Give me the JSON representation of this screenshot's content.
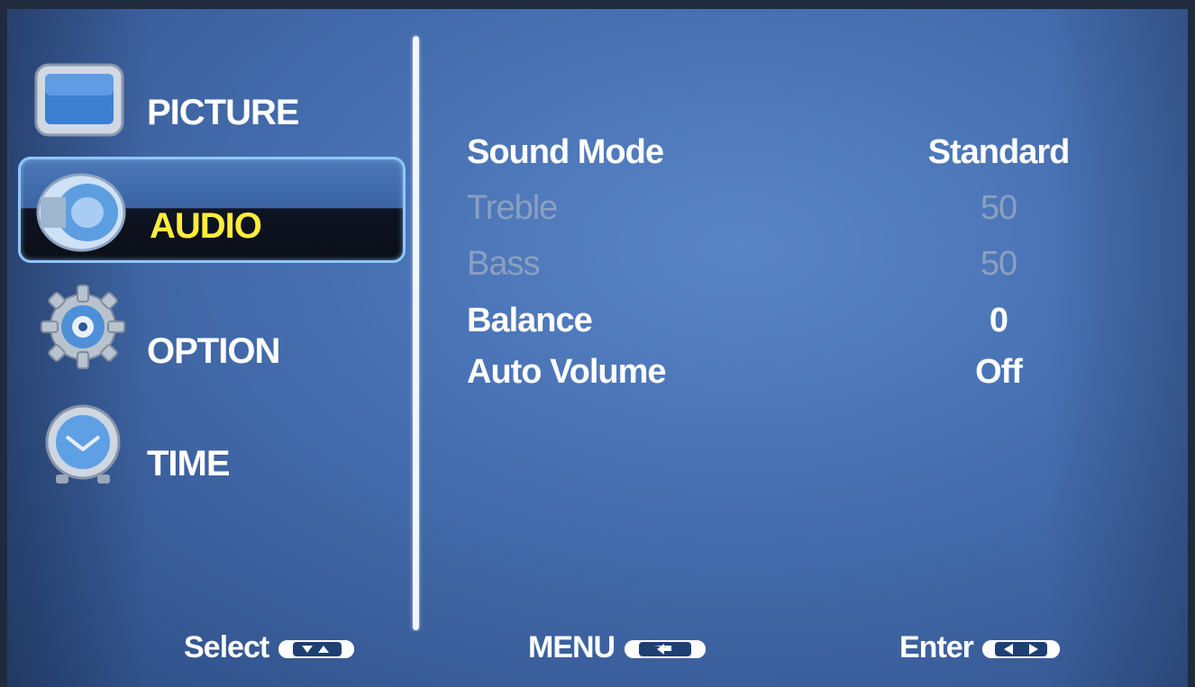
{
  "menu": {
    "categories": [
      {
        "label": "PICTURE",
        "icon": "tv-icon",
        "selected": false
      },
      {
        "label": "AUDIO",
        "icon": "speaker-icon",
        "selected": true
      },
      {
        "label": "OPTION",
        "icon": "gear-icon",
        "selected": false
      },
      {
        "label": "TIME",
        "icon": "clock-icon",
        "selected": false
      }
    ],
    "settings": [
      {
        "name": "Sound Mode",
        "value": "Standard",
        "enabled": true
      },
      {
        "name": "Treble",
        "value": "50",
        "enabled": false
      },
      {
        "name": "Bass",
        "value": "50",
        "enabled": false
      },
      {
        "name": "Balance",
        "value": "0",
        "enabled": true
      },
      {
        "name": "Auto Volume",
        "value": "Off",
        "enabled": true
      }
    ]
  },
  "footer": {
    "select_label": "Select",
    "menu_label": "MENU",
    "enter_label": "Enter"
  },
  "colors": {
    "selected_text": "#ffec3d",
    "highlight_border": "#8fc6ff",
    "disabled_text": "#8aa0c0"
  }
}
